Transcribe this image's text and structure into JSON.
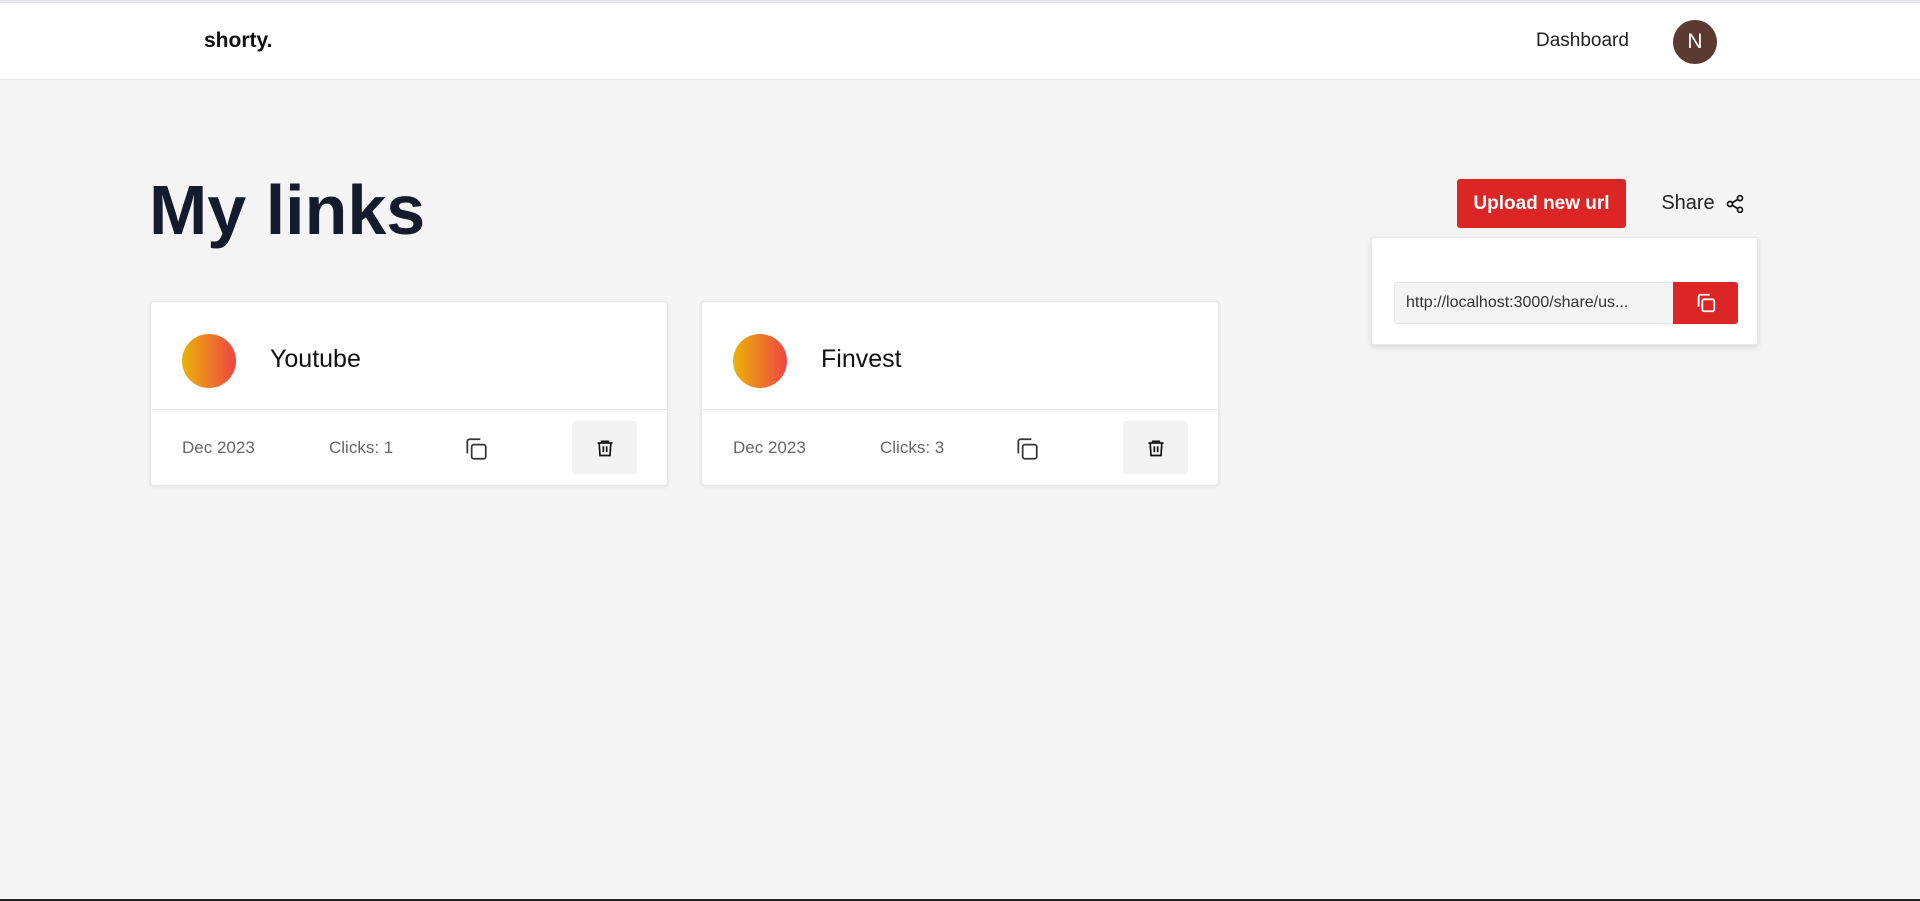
{
  "app": {
    "logo": "shorty."
  },
  "nav": {
    "dashboard_label": "Dashboard",
    "avatar_initial": "N"
  },
  "main": {
    "title": "My links",
    "upload_label": "Upload new url",
    "share_label": "Share"
  },
  "share_popover": {
    "url_value": "http://localhost:3000/share/us..."
  },
  "links": [
    {
      "name": "Youtube",
      "date": "Dec 2023",
      "clicks": "Clicks: 1"
    },
    {
      "name": "Finvest",
      "date": "Dec 2023",
      "clicks": "Clicks: 3"
    }
  ],
  "colors": {
    "accent": "#dc2626",
    "gradient_start": "#eab308",
    "gradient_end": "#ef4444",
    "avatar": "#5a3a31"
  },
  "icons": {
    "share": "share-icon",
    "copy": "copy-icon",
    "delete": "trash-icon"
  }
}
